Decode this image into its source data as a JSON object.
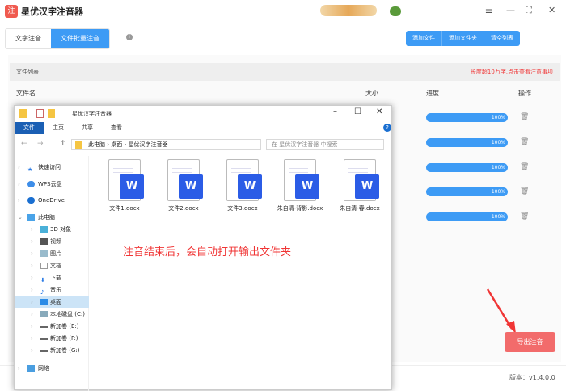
{
  "app": {
    "title": "星优汉字注音器",
    "logo": "注"
  },
  "window_controls": {
    "settings": "⚌",
    "minimize": "—",
    "maximize": "⛶",
    "close": "✕"
  },
  "tabs": [
    {
      "label": "文字注音"
    },
    {
      "label": "文件批量注音"
    }
  ],
  "toolbar": {
    "add_file": "添加文件",
    "add_folder": "添加文件夹",
    "clear_list": "清空列表"
  },
  "file_list": {
    "title": "文件列表",
    "notice": "长度超10万字,点击查看注意事项",
    "columns": {
      "name": "文件名",
      "size": "大小",
      "progress": "进度",
      "action": "操作"
    },
    "rows": [
      {
        "progress": "100%"
      },
      {
        "progress": "100%"
      },
      {
        "progress": "100%"
      },
      {
        "progress": "100%"
      },
      {
        "progress": "100%"
      }
    ]
  },
  "export_button": "导出注音",
  "version": "版本：v1.4.0.0",
  "explorer": {
    "title": "星优汉字注音器",
    "ribbon": [
      "文件",
      "主页",
      "共享",
      "查看"
    ],
    "breadcrumb": [
      "此电脑",
      "桌面",
      "星优汉字注音器"
    ],
    "search_placeholder": "在 星优汉字注音器 中搜索",
    "nav": [
      "快速访问",
      "WPS云盘",
      "OneDrive",
      "此电脑",
      "3D 对象",
      "视频",
      "图片",
      "文档",
      "下载",
      "音乐",
      "桌面",
      "本地磁盘 (C:)",
      "新加卷 (E:)",
      "新加卷 (F:)",
      "新加卷 (G:)",
      "网络"
    ],
    "files": [
      "文件1.docx",
      "文件2.docx",
      "文件3.docx",
      "朱自清-背影.docx",
      "朱自清-春.docx"
    ]
  },
  "annotation": "注音结束后，会自动打开输出文件夹",
  "colors": {
    "accent": "#3d9bf5",
    "export": "#f26b6b",
    "annotation": "#f03535"
  }
}
